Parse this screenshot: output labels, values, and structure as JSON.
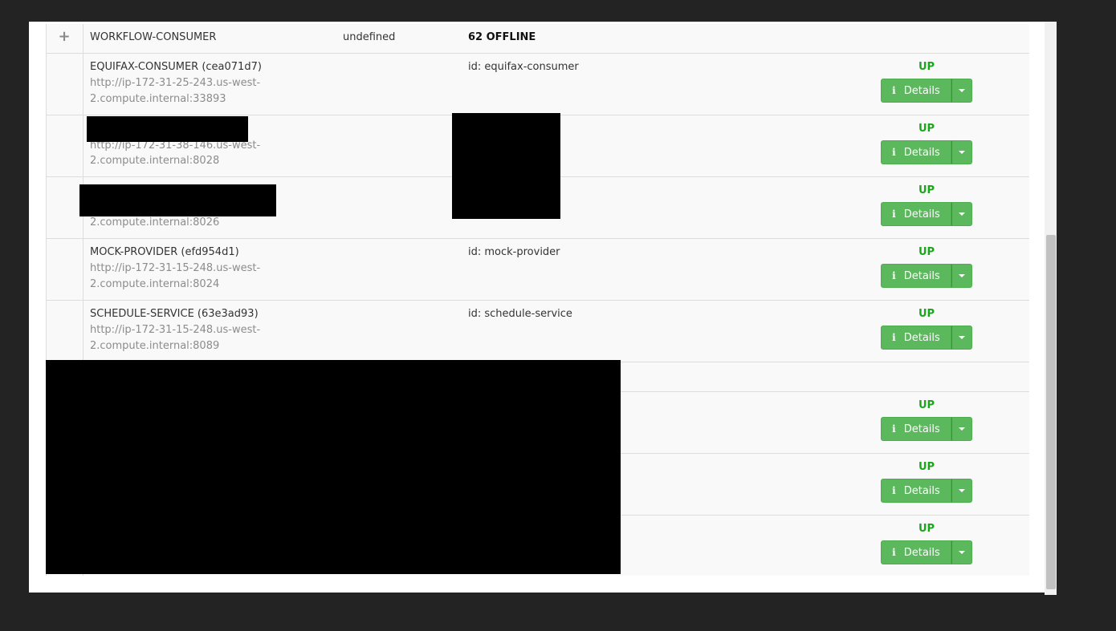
{
  "group": {
    "expand_icon": "plus-icon",
    "name": "WORKFLOW-CONSUMER",
    "value": "undefined",
    "summary": "62 OFFLINE"
  },
  "details_label": "Details",
  "rows": [
    {
      "name": "EQUIFAX-CONSUMER (cea071d7)",
      "url_1": "http://ip-172-31-25-243.us-west-",
      "url_2": "2.compute.internal:33893",
      "meta": "id: equifax-consumer",
      "status": "UP"
    },
    {
      "name": "",
      "url_1": "http://ip-172-31-38-146.us-west-",
      "url_2": "2.compute.internal:8028",
      "meta": "",
      "status": "UP"
    },
    {
      "name": "",
      "url_1": "",
      "url_2": "2.compute.internal:8026",
      "meta": "",
      "status": "UP"
    },
    {
      "name": "MOCK-PROVIDER (efd954d1)",
      "url_1": "http://ip-172-31-15-248.us-west-",
      "url_2": "2.compute.internal:8024",
      "meta": "id: mock-provider",
      "status": "UP"
    },
    {
      "name": "SCHEDULE-SERVICE (63e3ad93)",
      "url_1": "http://ip-172-31-15-248.us-west-",
      "url_2": "2.compute.internal:8089",
      "meta": "id: schedule-service",
      "status": "UP"
    },
    {
      "status": "UP"
    },
    {
      "status": "UP"
    },
    {
      "status": "UP"
    }
  ],
  "colors": {
    "up": "#1aa61a",
    "button": "#5cb85c"
  }
}
